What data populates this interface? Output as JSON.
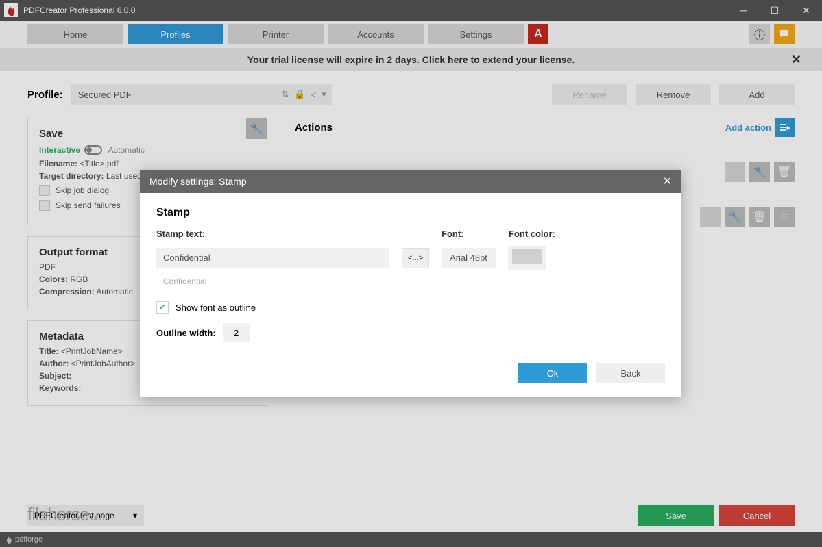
{
  "titlebar": {
    "title": "PDFCreator Professional 6.0.0"
  },
  "nav": {
    "home": "Home",
    "profiles": "Profiles",
    "printer": "Printer",
    "accounts": "Accounts",
    "settings": "Settings"
  },
  "trial": {
    "text": "Your trial license will expire in 2 days. Click here to extend your license."
  },
  "profile": {
    "label": "Profile:",
    "selected": "Secured PDF",
    "rename": "Rename",
    "remove": "Remove",
    "add": "Add"
  },
  "cards": {
    "save": {
      "title": "Save",
      "interactive": "Interactive",
      "auto": "Automatic",
      "filename_lbl": "Filename:",
      "filename_val": "<Title>.pdf",
      "target_lbl": "Target directory:",
      "target_val": "Last used d",
      "skip_job": "Skip job dialog",
      "skip_send": "Skip send failures"
    },
    "output": {
      "title": "Output format",
      "format": "PDF",
      "colors_lbl": "Colors:",
      "colors_val": "RGB",
      "comp_lbl": "Compression:",
      "comp_val": "Automatic"
    },
    "metadata": {
      "title": "Metadata",
      "title_lbl": "Title:",
      "title_val": "<PrintJobName>",
      "author_lbl": "Author:",
      "author_val": "<PrintJobAuthor>",
      "subject_lbl": "Subject:",
      "keywords_lbl": "Keywords:"
    }
  },
  "actions": {
    "title": "Actions",
    "add": "Add action"
  },
  "bottom": {
    "test_page": "PDFCreator test page",
    "save": "Save",
    "cancel": "Cancel"
  },
  "footer": {
    "brand": "pdfforge"
  },
  "modal": {
    "title": "Modify settings: Stamp",
    "heading": "Stamp",
    "stamp_text_lbl": "Stamp text:",
    "stamp_text_val": "Confidential",
    "stamp_hint": "Confidential",
    "token_btn": "<...>",
    "font_lbl": "Font:",
    "font_val": "Arial 48pt",
    "font_color_lbl": "Font color:",
    "show_outline": "Show font as outline",
    "outline_width_lbl": "Outline width:",
    "outline_width_val": "2",
    "ok": "Ok",
    "back": "Back"
  },
  "watermark": "filehorse"
}
